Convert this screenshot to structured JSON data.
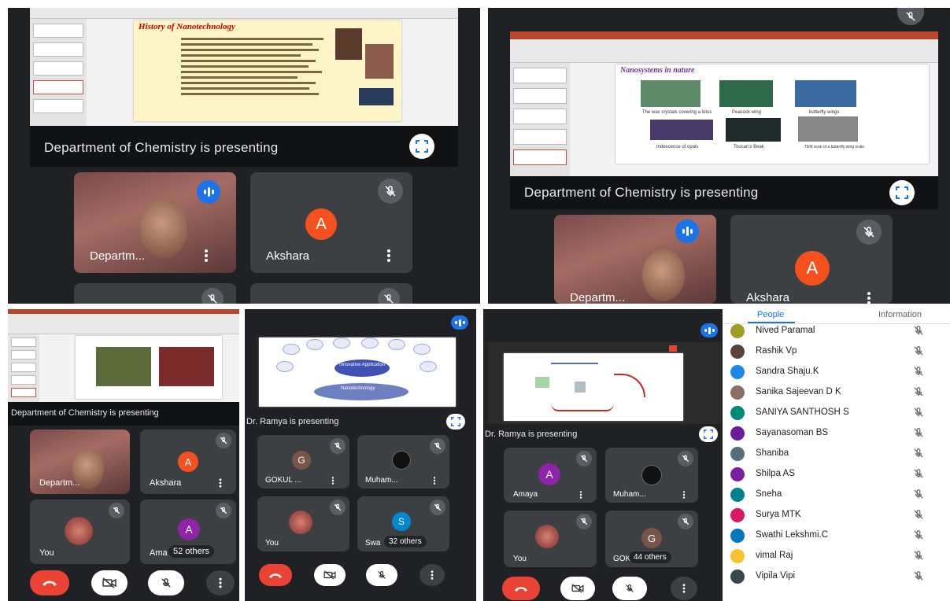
{
  "colors": {
    "meet_bg": "#202124",
    "tile_bg": "#3c4043",
    "accent_blue": "#1a73e8",
    "end_call_red": "#ea4335",
    "akshara_orange": "#f4511e",
    "amaya_purple": "#8e24aa",
    "gokul_brown": "#795548",
    "swathi_blue": "#0288d1"
  },
  "panel1": {
    "slide_title": "History of Nanotechnology",
    "presenting": "Department of Chemistry is presenting",
    "tile1_name": "Departm...",
    "tile2_avatar": "A",
    "tile2_name": "Akshara"
  },
  "panel2": {
    "slide_title": "Nanosystems in nature",
    "captions": [
      "The wax crystals covering a lotus",
      "Peacock wing",
      "butterfly wings",
      "Iridescence of opals",
      "Toucan's Beak",
      "TEM scan of a butterfly wing scale"
    ],
    "presenting": "Department of Chemistry is presenting",
    "tile1_name": "Departm...",
    "tile2_avatar": "A",
    "tile2_name": "Akshara"
  },
  "panel3": {
    "presenting": "Department of Chemistry is presenting",
    "tile1_name": "Departm...",
    "tile2_avatar": "A",
    "tile2_name": "Akshara",
    "tile3_name": "You",
    "tile4_avatar": "A",
    "tile4_name": "Ama",
    "others": "52 others"
  },
  "panel4": {
    "diagram_center": "Innovative Application",
    "diagram_base": "Nanotechnology",
    "presenting": "Dr. Ramya  is presenting",
    "tile1_avatar": "G",
    "tile1_name": "GOKUL ...",
    "tile2_name": "Muham...",
    "tile3_name": "You",
    "tile4_avatar": "S",
    "tile4_name": "Swa",
    "others": "32 others"
  },
  "panel5": {
    "presenting": "Dr. Ramya  is presenting",
    "tile1_avatar": "A",
    "tile1_name": "Amaya",
    "tile2_name": "Muham...",
    "tile3_name": "You",
    "tile4_avatar": "G",
    "tile4_name": "GOK",
    "others": "44 others"
  },
  "people": {
    "tabs": [
      "People",
      "Information"
    ],
    "list": [
      {
        "name": "Nived Paramal",
        "color": "#9e9d24"
      },
      {
        "name": "Rashik Vp",
        "color": "#5d4037"
      },
      {
        "name": "Sandra Shaju.K",
        "color": "#1e88e5"
      },
      {
        "name": "Sanika Sajeevan D K",
        "color": "#8d6e63"
      },
      {
        "name": "SANIYA SANTHOSH S",
        "color": "#00897b"
      },
      {
        "name": "Sayanasoman BS",
        "color": "#6a1b9a"
      },
      {
        "name": "Shaniba",
        "color": "#546e7a"
      },
      {
        "name": "Shilpa AS",
        "color": "#7b1fa2"
      },
      {
        "name": "Sneha",
        "color": "#00838f"
      },
      {
        "name": "Surya MTK",
        "color": "#d81b60"
      },
      {
        "name": "Swathi Lekshmi.C",
        "color": "#0277bd"
      },
      {
        "name": "vimal Raj",
        "color": "#fbc02d"
      },
      {
        "name": "Vipila Vipi",
        "color": "#37474f"
      }
    ]
  }
}
